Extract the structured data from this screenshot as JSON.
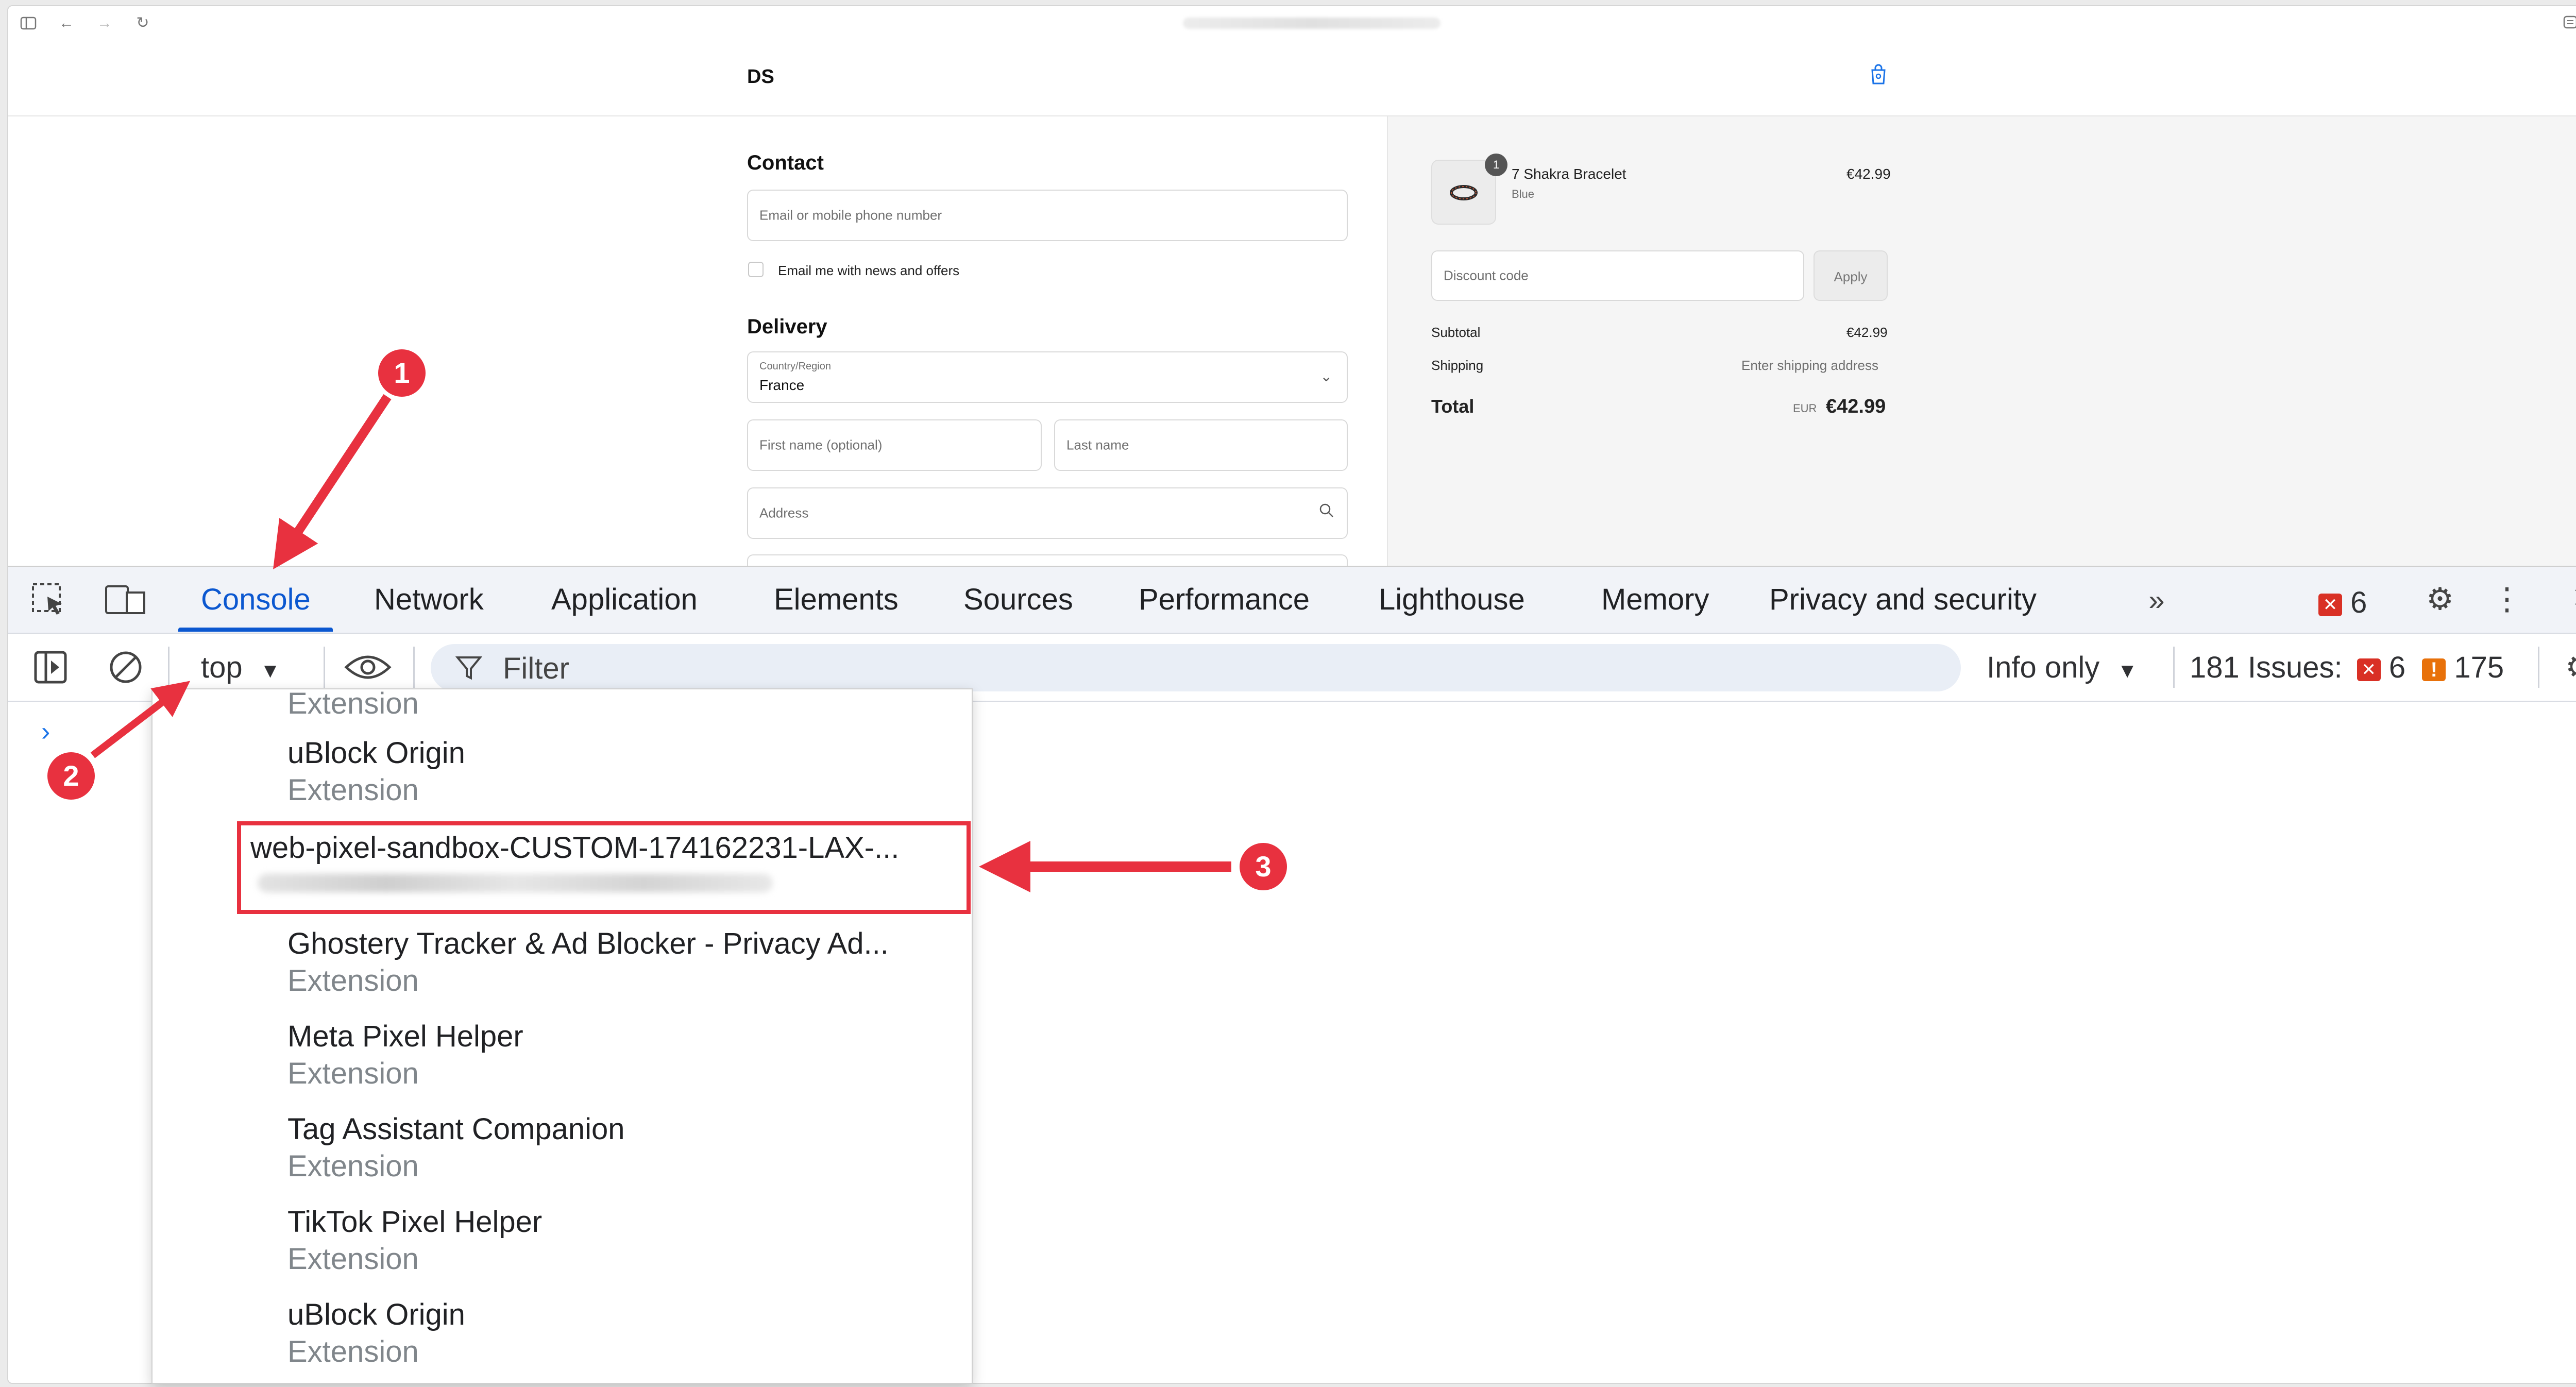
{
  "store": {
    "name": "DS"
  },
  "checkout": {
    "contact": {
      "heading": "Contact",
      "email_placeholder": "Email or mobile phone number",
      "news_label": "Email me with news and offers"
    },
    "delivery": {
      "heading": "Delivery",
      "country_label": "Country/Region",
      "country_value": "France",
      "first_name_placeholder": "First name (optional)",
      "last_name_placeholder": "Last name",
      "address_placeholder": "Address"
    }
  },
  "summary": {
    "item": {
      "name": "7 Shakra Bracelet",
      "variant": "Blue",
      "price": "€42.99",
      "quantity": "1"
    },
    "discount_placeholder": "Discount code",
    "apply_label": "Apply",
    "subtotal_label": "Subtotal",
    "subtotal_value": "€42.99",
    "shipping_label": "Shipping",
    "shipping_value": "Enter shipping address",
    "total_label": "Total",
    "currency": "EUR",
    "total_value": "€42.99"
  },
  "devtools": {
    "tabs": [
      "Console",
      "Network",
      "Application",
      "Elements",
      "Sources",
      "Performance",
      "Lighthouse",
      "Memory",
      "Privacy and security"
    ],
    "active_tab": "Console",
    "error_count": "6",
    "console_toolbar": {
      "context": "top",
      "filter_placeholder": "Filter",
      "level": "Info only",
      "issues_label": "181 Issues:",
      "issues_errors": "6",
      "issues_warnings": "175"
    },
    "context_menu": [
      {
        "name": "",
        "sub": "Extension"
      },
      {
        "name": "uBlock Origin",
        "sub": "Extension"
      },
      {
        "name": "web-pixel-sandbox-CUSTOM-174162231-LAX-...",
        "sub": ""
      },
      {
        "name": "Ghostery Tracker & Ad Blocker - Privacy Ad...",
        "sub": "Extension"
      },
      {
        "name": "Meta Pixel Helper",
        "sub": "Extension"
      },
      {
        "name": "Tag Assistant Companion",
        "sub": "Extension"
      },
      {
        "name": "TikTok Pixel Helper",
        "sub": "Extension"
      },
      {
        "name": "uBlock Origin",
        "sub": "Extension"
      }
    ]
  },
  "annotations": {
    "step1": "1",
    "step2": "2",
    "step3": "3",
    "color": "#e8313f"
  }
}
